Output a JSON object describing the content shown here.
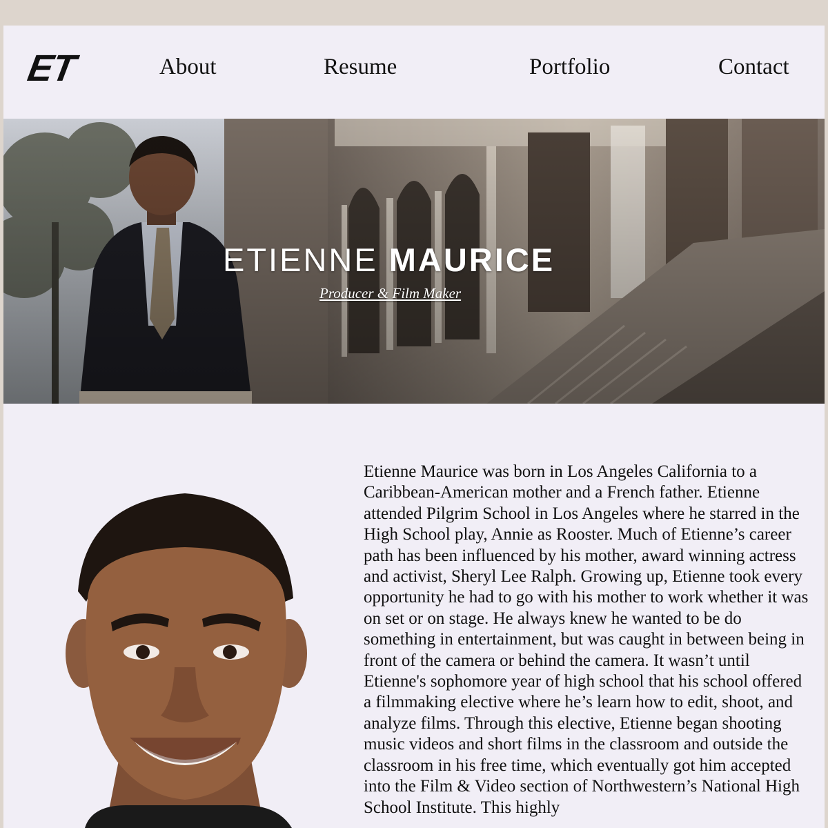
{
  "header": {
    "logo": "ET",
    "nav": {
      "about": "About",
      "resume": "Resume",
      "portfolio": "Portfolio",
      "contact": "Contact"
    }
  },
  "hero": {
    "first_name": "ETIENNE",
    "last_name": "MAURICE",
    "subtitle": "Producer & Film Maker"
  },
  "about": {
    "bio": "Etienne Maurice was born in Los Angeles California to a Caribbean-American mother and a French father. Etienne attended Pilgrim School in Los Angeles where he starred in the High School play, Annie as Rooster. Much of Etienne’s career path has been influenced by his mother, award winning actress and activist, Sheryl Lee Ralph. Growing up, Etienne took every opportunity he had to go with his mother to work whether it was on set or on stage. He always knew he wanted to be do something in entertainment, but was caught in between being in front of the camera or behind the camera. It wasn’t until Etienne's sophomore year of high school that his school offered a filmmaking elective where he’s learn how to edit, shoot, and analyze films. Through this elective, Etienne began shooting music videos and short films in the classroom and outside the classroom in his free time, which eventually got him accepted into the Film & Video section of Northwestern’s National High School Institute. This highly"
  },
  "colors": {
    "outer_background": "#ddd5cd",
    "page_background": "#f1eef6",
    "text": "#111111"
  }
}
